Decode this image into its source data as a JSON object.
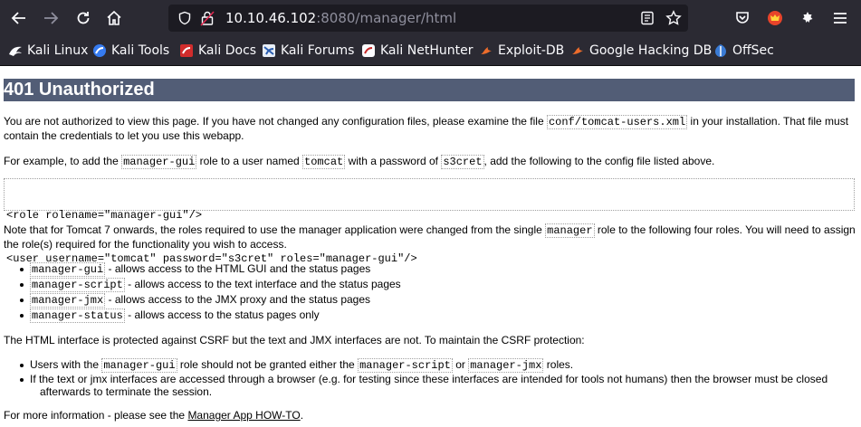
{
  "browser": {
    "url_host": "10.10.46.102",
    "url_port_path": ":8080/manager/html",
    "bookmarks": [
      "Kali Linux",
      "Kali Tools",
      "Kali Docs",
      "Kali Forums",
      "Kali NetHunter",
      "Exploit-DB",
      "Google Hacking DB",
      "OffSec"
    ]
  },
  "page": {
    "title": "401 Unauthorized",
    "p1_a": "You are not authorized to view this page. If you have not changed any configuration files, please examine the file ",
    "p1_code": "conf/tomcat-users.xml",
    "p1_b": " in your installation. That file must",
    "p1_c": "contain the credentials to let you use this webapp.",
    "p2_a": "For example, to add the ",
    "p2_code1": "manager-gui",
    "p2_b": " role to a user named ",
    "p2_code2": "tomcat",
    "p2_c": " with a password of ",
    "p2_code3": "s3cret",
    "p2_d": ", add the following to the config file listed above.",
    "pre_line1": "<role rolename=\"manager-gui\"/>",
    "pre_line2": "<user username=\"tomcat\" password=\"s3cret\" roles=\"manager-gui\"/>",
    "p3_a": "Note that for Tomcat 7 onwards, the roles required to use the manager application were changed from the single ",
    "p3_code": "manager",
    "p3_b": " role to the following four roles. You will need to assign",
    "p3_c": "the role(s) required for the functionality you wish to access.",
    "roles": [
      {
        "code": "manager-gui",
        "text": " - allows access to the HTML GUI and the status pages"
      },
      {
        "code": "manager-script",
        "text": " - allows access to the text interface and the status pages"
      },
      {
        "code": "manager-jmx",
        "text": " - allows access to the JMX proxy and the status pages"
      },
      {
        "code": "manager-status",
        "text": " - allows access to the status pages only"
      }
    ],
    "p4": "The HTML interface is protected against CSRF but the text and JMX interfaces are not. To maintain the CSRF protection:",
    "csrf1_a": "Users with the ",
    "csrf1_code1": "manager-gui",
    "csrf1_b": " role should not be granted either the ",
    "csrf1_code2": "manager-script",
    "csrf1_c": " or ",
    "csrf1_code3": "manager-jmx",
    "csrf1_d": " roles.",
    "csrf2_a": "If the text or jmx interfaces are accessed through a browser (e.g. for testing since these interfaces are intended for tools not humans) then the browser must be closed",
    "csrf2_b": "afterwards to terminate the session.",
    "p5_a": "For more information - please see the ",
    "p5_link": "Manager App HOW-TO",
    "p5_b": "."
  }
}
